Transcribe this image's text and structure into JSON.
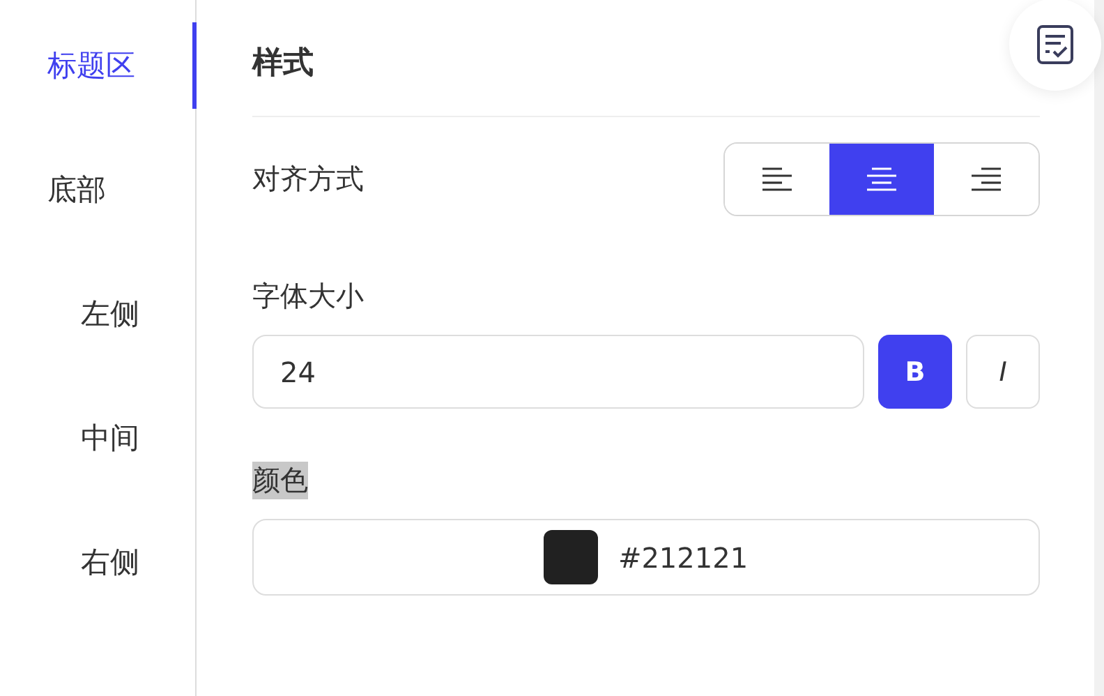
{
  "sidebar": {
    "items": [
      {
        "label": "标题区",
        "selected": true
      },
      {
        "label": "底部",
        "selected": false,
        "children": [
          {
            "label": "左侧",
            "selected": false
          },
          {
            "label": "中间",
            "selected": false
          },
          {
            "label": "右侧",
            "selected": false
          }
        ]
      }
    ]
  },
  "panel": {
    "title": "样式",
    "alignment": {
      "label": "对齐方式",
      "options": [
        {
          "kind": "left",
          "selected": false
        },
        {
          "kind": "center",
          "selected": true
        },
        {
          "kind": "right",
          "selected": false
        }
      ]
    },
    "font_size": {
      "label": "字体大小",
      "value": "24",
      "styles": [
        {
          "label": "B",
          "kind": "bold",
          "selected": true
        },
        {
          "label": "I",
          "kind": "italic",
          "selected": false
        }
      ]
    },
    "color": {
      "label": "颜色",
      "highlighted": true,
      "value": "#212121"
    }
  }
}
